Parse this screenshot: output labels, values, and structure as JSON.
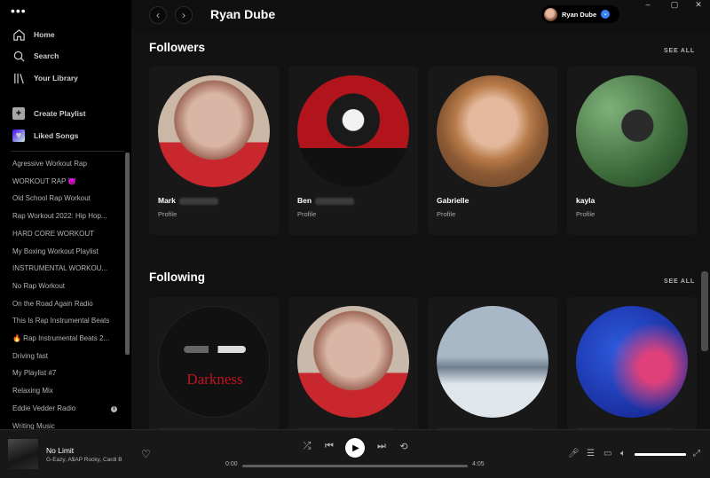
{
  "sidebar": {
    "nav": [
      {
        "label": "Home",
        "icon": "home-icon"
      },
      {
        "label": "Search",
        "icon": "search-icon"
      },
      {
        "label": "Your Library",
        "icon": "library-icon"
      }
    ],
    "create_playlist": "Create Playlist",
    "liked_songs": "Liked Songs",
    "playlists": [
      "Agressive Workout Rap",
      "WORKOUT RAP 😈",
      "Old School Rap Workout",
      "Rap Workout 2022: Hip Hop...",
      "HARD CORE WORKOUT",
      "My Boxing Workout Playlist",
      "INSTRUMENTAL WORKOU...",
      "No Rap Workout",
      "On the Road Again Radio",
      "This Is Rap Instrumental Beats",
      "🔥 Rap Instrumental Beats 2...",
      "Driving fast",
      "My Playlist #7",
      "Relaxing Mix",
      "Eddie Vedder Radio",
      "Writing Music"
    ]
  },
  "header": {
    "title": "Ryan Dube",
    "user_name": "Ryan Dube"
  },
  "followers": {
    "title": "Followers",
    "see_all": "SEE ALL",
    "cards": [
      {
        "name": "Mark",
        "sub": "Profile"
      },
      {
        "name": "Ben",
        "sub": "Profile"
      },
      {
        "name": "Gabrielle",
        "sub": "Profile"
      },
      {
        "name": "kayla",
        "sub": "Profile"
      }
    ]
  },
  "following": {
    "title": "Following",
    "see_all": "SEE ALL",
    "cards": [
      {
        "art_text": "Darkness"
      },
      {},
      {},
      {}
    ]
  },
  "player": {
    "track": "No Limit",
    "artists": "G-Eazy, A$AP Rocky, Cardi B",
    "elapsed": "0:00",
    "duration": "4:05",
    "progress": 0,
    "volume": 1
  }
}
